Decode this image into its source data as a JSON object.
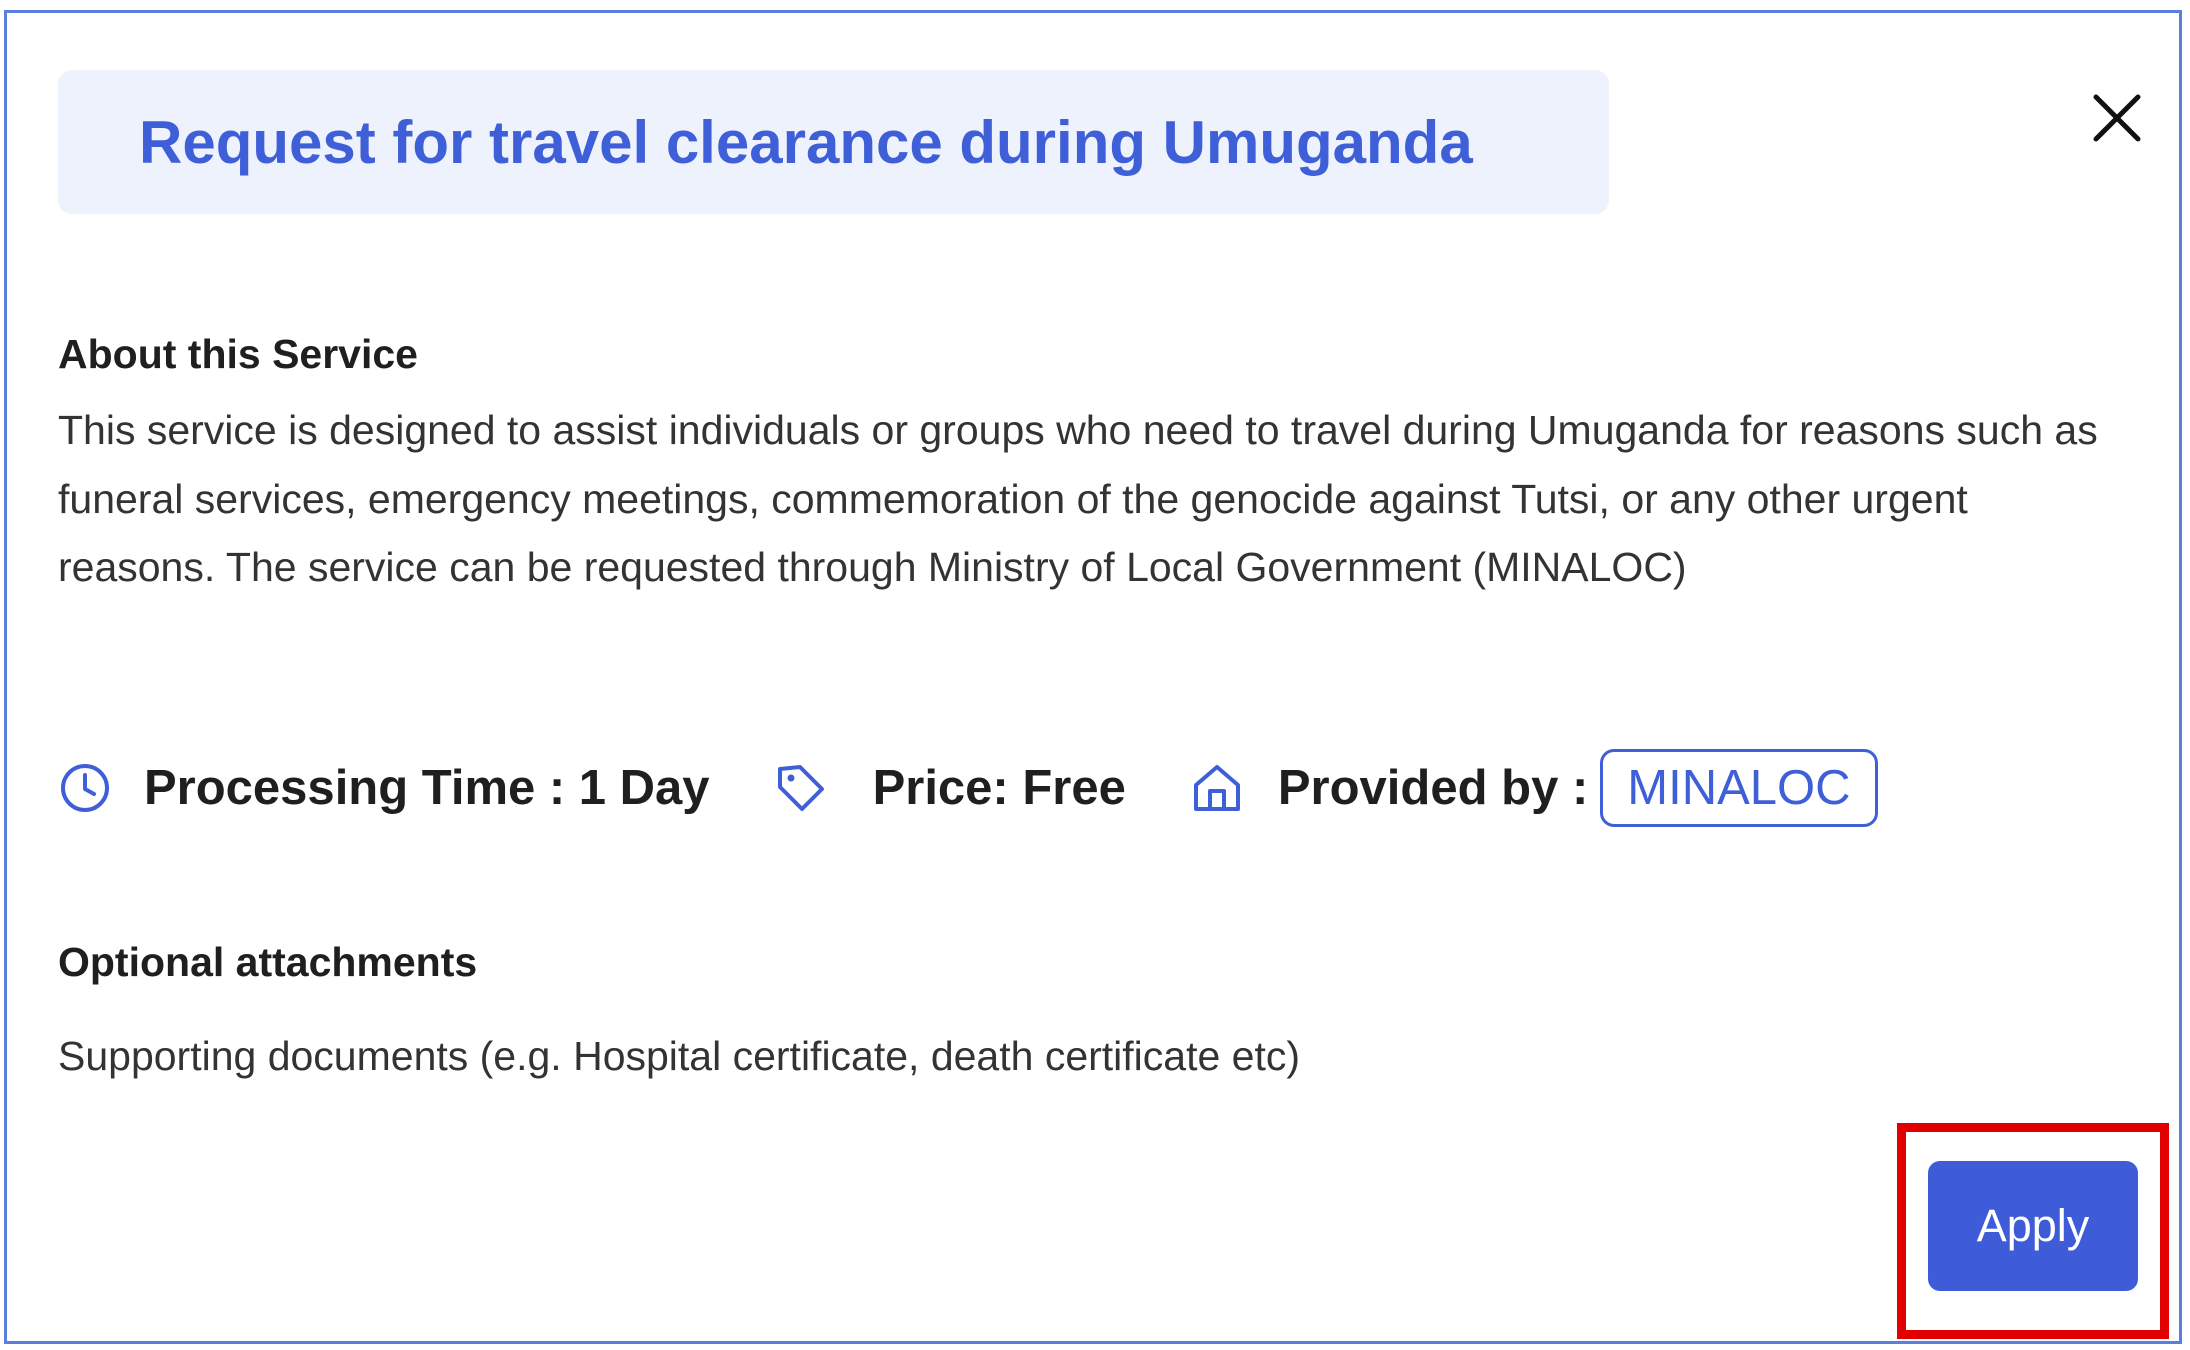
{
  "dialog": {
    "title": "Request for travel clearance during Umuganda",
    "close_icon": "close-icon"
  },
  "about": {
    "heading": "About this Service",
    "description": "This service is designed to assist individuals or groups who need to travel during Umuganda for reasons such as funeral services, emergency meetings, commemoration of the genocide against Tutsi, or any other urgent reasons. The service can be requested through Ministry of Local Government (MINALOC)"
  },
  "meta": {
    "processing_time": "Processing Time : 1 Day",
    "price": "Price: Free",
    "provided_by_label": "Provided by :",
    "provider": "MINALOC",
    "icons": [
      "clock-icon",
      "tag-icon",
      "home-icon"
    ]
  },
  "attachments": {
    "heading": "Optional attachments",
    "items": [
      "Supporting documents (e.g. Hospital certificate, death certificate etc)"
    ]
  },
  "actions": {
    "apply_label": "Apply"
  },
  "colors": {
    "accent": "#3f5fd8",
    "title_background": "#eef2fc",
    "dialog_border": "#5b7fdc",
    "highlight": "#e00000",
    "text": "#333333"
  }
}
